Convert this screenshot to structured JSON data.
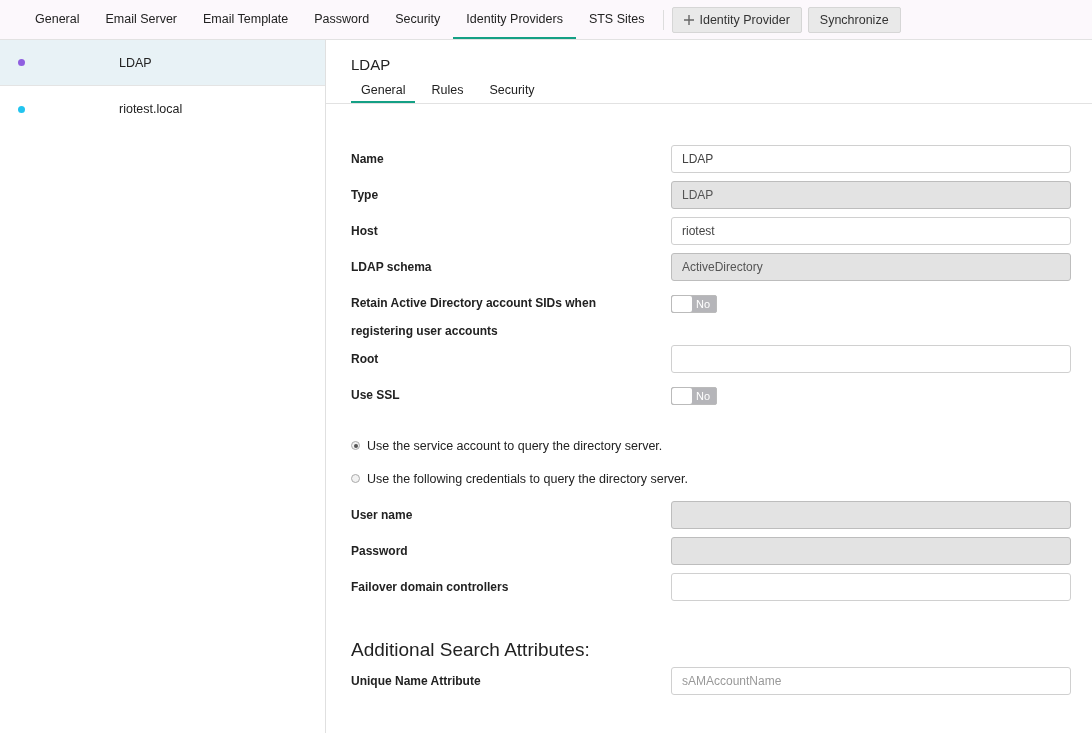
{
  "top_tabs": [
    {
      "label": "General",
      "selected": false
    },
    {
      "label": "Email Server",
      "selected": false
    },
    {
      "label": "Email Template",
      "selected": false
    },
    {
      "label": "Password",
      "selected": false
    },
    {
      "label": "Security",
      "selected": false
    },
    {
      "label": "Identity Providers",
      "selected": true
    },
    {
      "label": "STS Sites",
      "selected": false
    }
  ],
  "toolbar_buttons": [
    {
      "label": "Identity Provider",
      "kind": "add"
    },
    {
      "label": "Synchronize",
      "kind": "plain"
    }
  ],
  "sidebar": {
    "items": [
      {
        "label": "LDAP",
        "selected": true,
        "color": "#8f5fe0"
      },
      {
        "label": "riotest.local",
        "selected": false,
        "color": "#22c4ef"
      }
    ]
  },
  "detail": {
    "title": "LDAP",
    "tabs": [
      {
        "label": "General",
        "selected": true
      },
      {
        "label": "Rules",
        "selected": false
      },
      {
        "label": "Security",
        "selected": false
      }
    ],
    "fields": [
      {
        "kind": "input",
        "label": "Name",
        "value": "LDAP",
        "disabled": false
      },
      {
        "kind": "input",
        "label": "Type",
        "value": "LDAP",
        "disabled": true
      },
      {
        "kind": "input",
        "label": "Host",
        "value": "riotest",
        "disabled": false
      },
      {
        "kind": "input",
        "label": "LDAP schema",
        "value": "ActiveDirectory",
        "disabled": true
      },
      {
        "kind": "toggle",
        "label": "Retain Active Directory account SIDs when registering user accounts",
        "on": false,
        "state_text": "No"
      },
      {
        "kind": "input",
        "label": "Root",
        "disabled": false
      },
      {
        "kind": "toggle",
        "label": "Use SSL",
        "on": false,
        "state_text": "No"
      }
    ],
    "radios": [
      {
        "label": "Use the service account to query the directory server.",
        "selected": true
      },
      {
        "label": "Use the following credentials to query the directory server.",
        "selected": false
      }
    ],
    "credential_fields": [
      {
        "kind": "input",
        "label": "User name",
        "disabled": true
      },
      {
        "kind": "input",
        "label": "Password",
        "disabled": true
      },
      {
        "kind": "input",
        "label": "Failover domain controllers",
        "disabled": false
      }
    ],
    "search_heading": "Additional Search Attributes:",
    "search_fields": [
      {
        "kind": "input",
        "label": "Unique Name Attribute",
        "placeholder": "sAMAccountName",
        "disabled": false
      }
    ]
  }
}
